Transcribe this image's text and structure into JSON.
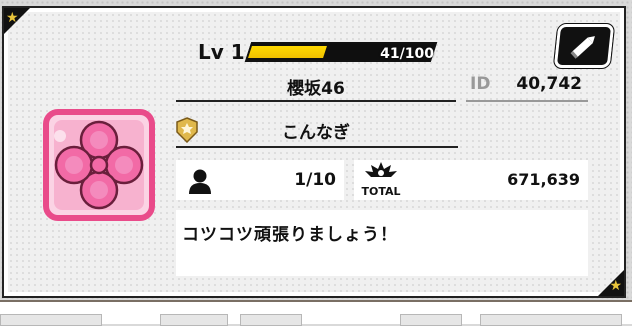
{
  "profile": {
    "level_label": "Lv 1",
    "exp_current": 41,
    "exp_max": 100,
    "exp_text": "41/100",
    "team_name": "櫻坂46",
    "id_label": "ID",
    "id_value": "40,742",
    "username": "こんなぎ",
    "player_count": "1/10",
    "total_label": "TOTAL",
    "total_value": "671,639",
    "comment": "コツコツ頑張りましょう！"
  },
  "icons": {
    "edit": "pencil-icon",
    "rank": "rank-badge-icon",
    "player": "person-icon",
    "total": "explosion-total-icon",
    "emblem": "pink-flower-emblem",
    "corner": "star-icon"
  },
  "colors": {
    "exp_fill": "#ffd900",
    "emblem_pink": "#f26aa6",
    "emblem_border": "#e94b8a",
    "badge_gold": "#e0b84b"
  }
}
